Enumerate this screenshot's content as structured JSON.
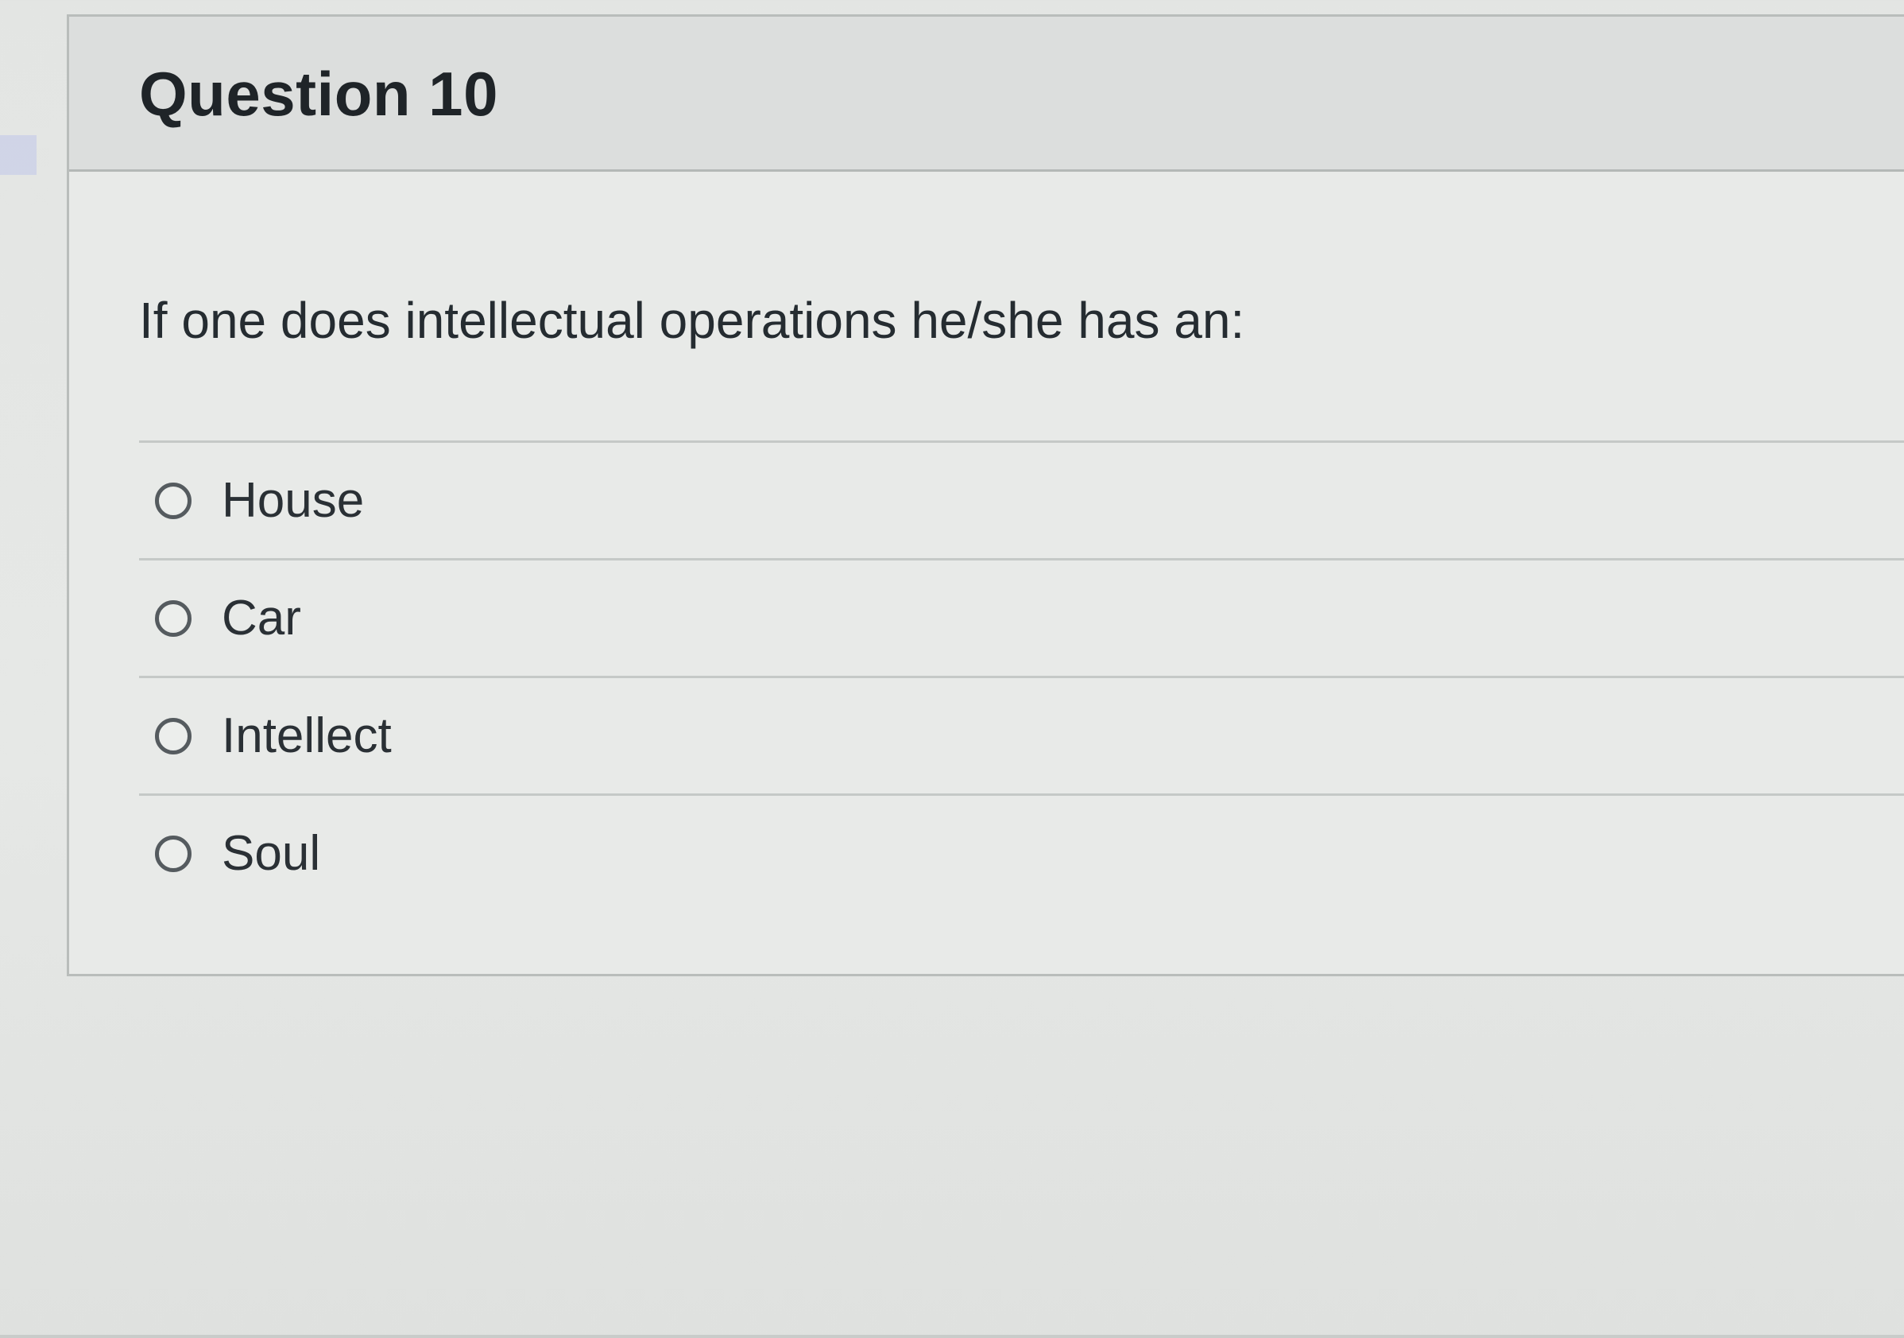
{
  "question": {
    "title": "Question 10",
    "prompt": "If one does intellectual operations he/she has an:",
    "answers": [
      {
        "label": "House",
        "selected": false
      },
      {
        "label": "Car",
        "selected": false
      },
      {
        "label": "Intellect",
        "selected": false
      },
      {
        "label": "Soul",
        "selected": false
      }
    ]
  },
  "colors": {
    "header_background": "#dcdedd",
    "body_background": "#e8eae8",
    "text": "#2d3b45"
  }
}
